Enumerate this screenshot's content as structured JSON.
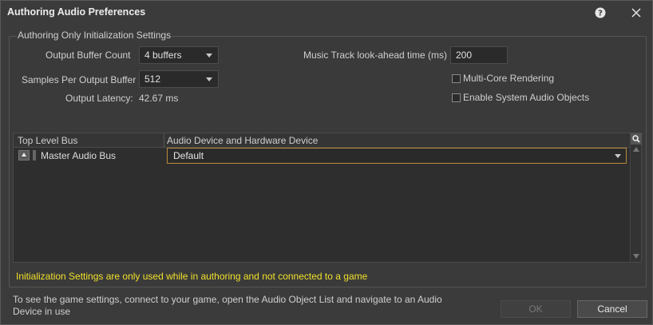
{
  "window": {
    "title": "Authoring Audio Preferences",
    "help_icon": "help-circle-icon",
    "close_icon": "close-icon"
  },
  "group": {
    "title": "Authoring Only Initialization Settings",
    "output_buffer_count": {
      "label": "Output Buffer Count",
      "value": "4 buffers"
    },
    "samples_per_buffer": {
      "label": "Samples Per Output Buffer",
      "value": "512"
    },
    "output_latency": {
      "label": "Output Latency:",
      "value": "42.67 ms"
    },
    "music_lookahead": {
      "label": "Music Track look-ahead time (ms)",
      "value": "200"
    },
    "multicore": {
      "label": "Multi-Core Rendering",
      "checked": false
    },
    "system_audio_objects": {
      "label": "Enable System Audio Objects",
      "checked": false
    }
  },
  "grid": {
    "columns": [
      "Top Level Bus",
      "Audio Device and Hardware Device"
    ],
    "rows": [
      {
        "bus": "Master Audio Bus",
        "device": "Default"
      }
    ],
    "search_icon": "search-icon"
  },
  "warning": "Initialization Settings are only used while in authoring and not connected to a game",
  "footer": {
    "info": "To see the game settings, connect to your game, open the Audio Object List and navigate to an Audio Device in use",
    "ok_label": "OK",
    "cancel_label": "Cancel"
  },
  "colors": {
    "warning": "#f0e02a",
    "focus_border": "#b88a3c"
  }
}
